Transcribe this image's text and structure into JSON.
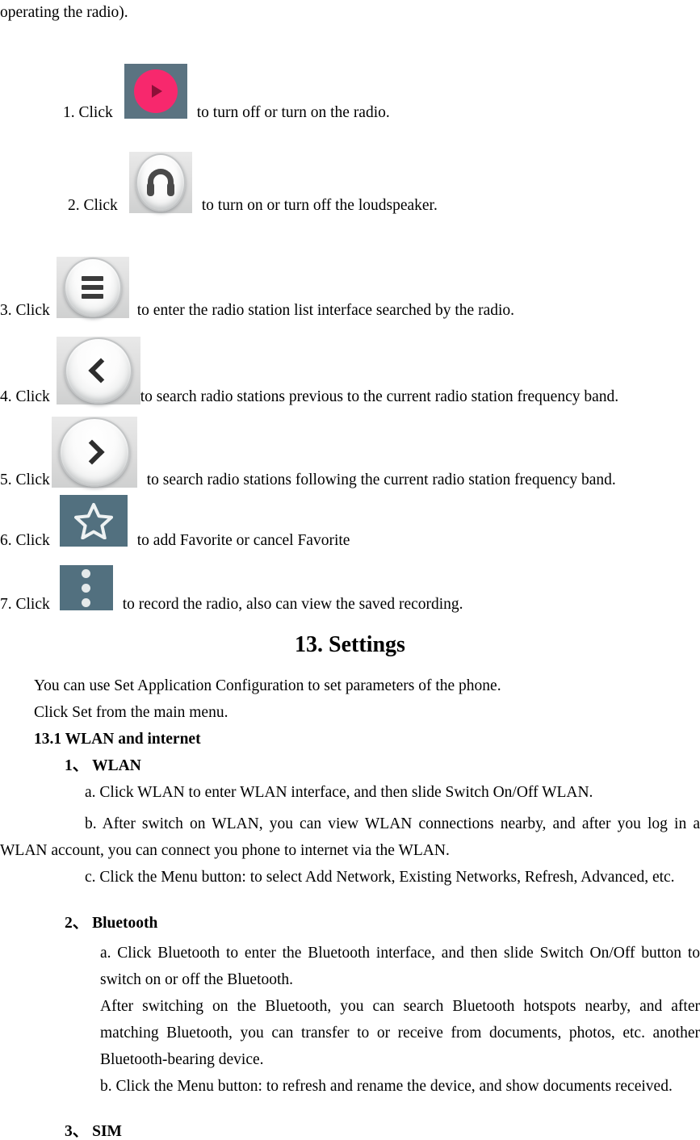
{
  "document": {
    "continuation_line": "operating the radio).",
    "radio_steps": [
      {
        "lead": "1. Click",
        "icon": "radio-power-play-icon",
        "tail": "to turn off or turn on the radio."
      },
      {
        "lead": "2. Click",
        "icon": "loudspeaker-headphone-icon",
        "tail": "to turn on or turn off the loudspeaker."
      },
      {
        "lead": "3. Click",
        "icon": "station-list-menu-icon",
        "tail": "to enter the radio station list interface searched by the radio."
      },
      {
        "lead": "4. Click",
        "icon": "previous-station-chevron-left-icon",
        "tail": "to search radio stations previous to the current radio station frequency band."
      },
      {
        "lead": "5. Click",
        "icon": "next-station-chevron-right-icon",
        "tail": "to search radio stations following the current radio station frequency band."
      },
      {
        "lead": "6. Click",
        "icon": "favorite-star-icon",
        "tail": "to add Favorite or cancel Favorite"
      },
      {
        "lead": "7. Click",
        "icon": "overflow-three-dots-icon",
        "tail": "to record the radio, also can view the saved recording."
      }
    ],
    "chapter": {
      "heading": "13. Settings",
      "intro_line_1": "You can use Set Application Configuration to set parameters of the phone.",
      "intro_line_2": "Click Set from the main menu.",
      "section_13_1": "13.1 WLAN and internet",
      "item_1": "1、 WLAN",
      "wlan_a": "a. Click WLAN to enter WLAN interface, and then slide Switch On/Off WLAN.",
      "wlan_b": "b. After switch on WLAN, you can view WLAN connections nearby, and after you log in a WLAN account, you can connect you phone to internet via the WLAN.",
      "wlan_c": "c. Click the Menu button: to select Add Network, Existing Networks, Refresh, Advanced, etc.",
      "item_2": "2、 Bluetooth",
      "bt_a": "a. Click Bluetooth to enter the Bluetooth interface, and then slide Switch On/Off button to switch on or off the Bluetooth.",
      "bt_b": "After switching on the Bluetooth, you can search Bluetooth hotspots nearby, and after matching Bluetooth, you can transfer to or receive from documents, photos, etc. another Bluetooth-bearing device.",
      "bt_c": "b. Click the Menu button: to refresh and rename the device, and show documents received.",
      "item_3": "3、 SIM"
    }
  },
  "colors": {
    "slate_icon_bg": "#52707f",
    "slate_play_bg": "#5b7381",
    "pink_accent": "#f7286d",
    "play_triangle": "#8c1038",
    "button_dark_glyph": "#3b3b3b",
    "page_bg": "#ffffff",
    "text": "#000000"
  }
}
